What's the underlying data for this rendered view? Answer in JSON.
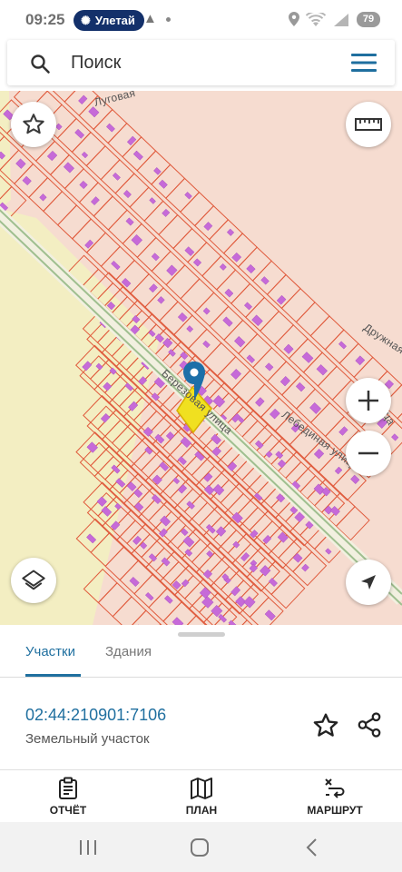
{
  "status_bar": {
    "time": "09:25",
    "pill_label": "Улетай",
    "battery": "79"
  },
  "search": {
    "placeholder": "Поиск"
  },
  "map": {
    "street_labels": [
      "Луговая",
      "Березовая улица",
      "Лебединая улица",
      "Дружная",
      "улица"
    ],
    "colors": {
      "parcel_fill": "#f6dcd0",
      "parcel_border": "#e05a3c",
      "building_fill": "#c66ad8",
      "field_fill": "#f3eec2",
      "road_line": "#9fbf8f",
      "pin": "#1c6fa8",
      "selected_parcel": "#f0e020"
    },
    "icons": [
      "favorite-star-icon",
      "ruler-icon",
      "zoom-in-icon",
      "zoom-out-icon",
      "layers-icon",
      "navigation-arrow-icon"
    ]
  },
  "sheet": {
    "tabs": [
      "Участки",
      "Здания"
    ],
    "active_tab": "Участки",
    "parcel_id": "02:44:210901:7106",
    "parcel_type": "Земельный участок",
    "actions": [
      {
        "label": "ОТЧЁТ",
        "icon": "report-clipboard-icon"
      },
      {
        "label": "ПЛАН",
        "icon": "map-plan-icon"
      },
      {
        "label": "МАРШРУТ",
        "icon": "route-icon"
      }
    ]
  },
  "navbar": {
    "icons": [
      "recent-apps-icon",
      "home-icon",
      "back-icon"
    ]
  }
}
